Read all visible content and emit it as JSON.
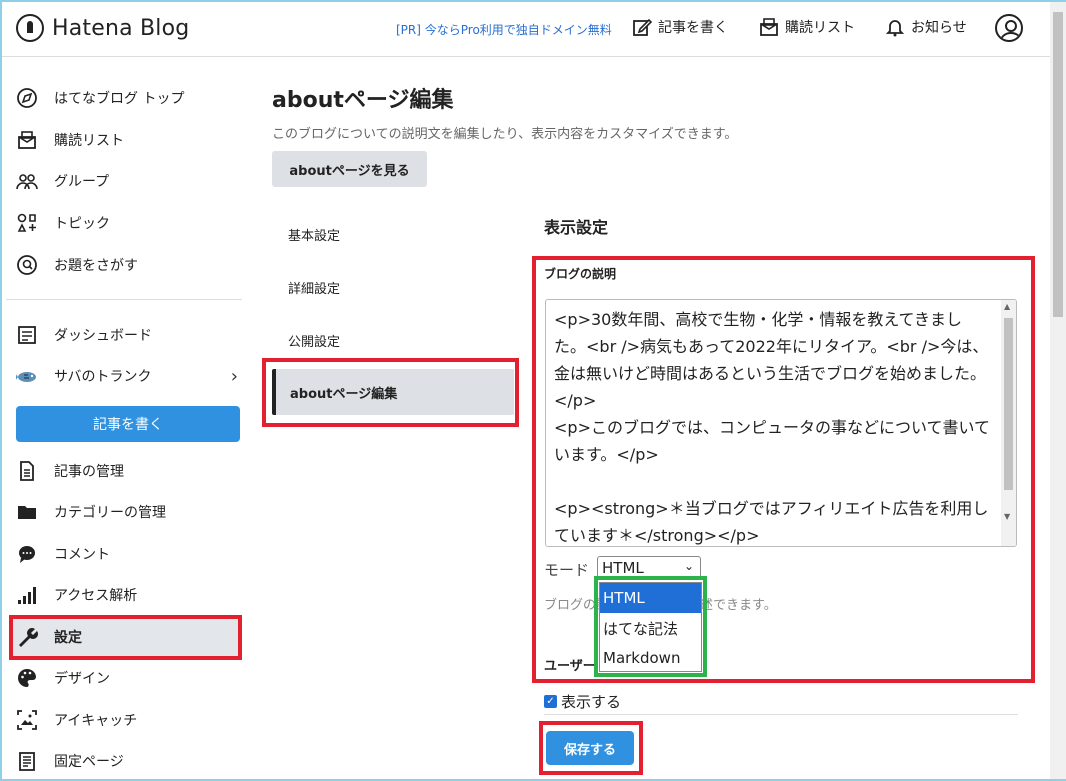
{
  "header": {
    "logo_text": "Hatena Blog",
    "pr_link": "[PR] 今ならPro利用で独自ドメイン無料",
    "write": "記事を書く",
    "reading_list": "購読リスト",
    "notifications": "お知らせ"
  },
  "sidebar": {
    "top_items": [
      {
        "label": "はてなブログ トップ",
        "icon": "compass-icon"
      },
      {
        "label": "購読リスト",
        "icon": "reading-list-icon"
      },
      {
        "label": "グループ",
        "icon": "group-icon"
      },
      {
        "label": "トピック",
        "icon": "topic-icon"
      },
      {
        "label": "お題をさがす",
        "icon": "search-theme-icon"
      }
    ],
    "dashboard": "ダッシュボード",
    "blog_name": "サバのトランク",
    "write_button": "記事を書く",
    "manage_items": [
      {
        "label": "記事の管理",
        "icon": "document-icon"
      },
      {
        "label": "カテゴリーの管理",
        "icon": "folder-icon"
      },
      {
        "label": "コメント",
        "icon": "comment-icon"
      },
      {
        "label": "アクセス解析",
        "icon": "bar-chart-icon"
      },
      {
        "label": "設定",
        "icon": "wrench-icon"
      },
      {
        "label": "デザイン",
        "icon": "palette-icon"
      },
      {
        "label": "アイキャッチ",
        "icon": "image-icon"
      },
      {
        "label": "固定ページ",
        "icon": "page-icon"
      }
    ]
  },
  "main": {
    "title": "aboutページ編集",
    "description": "このブログについての説明文を編集したり、表示内容をカスタマイズできます。",
    "view_button": "aboutページを見る",
    "subnav": [
      "基本設定",
      "詳細設定",
      "公開設定",
      "aboutページ編集"
    ],
    "section_title": "表示設定",
    "field_label": "ブログの説明",
    "textarea_value": "<p>30数年間、高校で生物・化学・情報を教えてきました。<br />病気もあって2022年にリタイア。<br />今は、金は無いけど時間はあるという生活でブログを始めました。</p>\n<p>このブログでは、コンピュータの事などについて書いています。</p>\n\n<p><strong>＊当ブログではアフィリエイト広告を利用しています＊</strong></p>",
    "mode_label": "モード",
    "mode_selected": "HTML",
    "mode_options": [
      "HTML",
      "はてな記法",
      "Markdown"
    ],
    "help_text": "ブログの説明など自由に記述できます。",
    "user_label": "ユーザー",
    "show_checkbox": "表示する",
    "save_button": "保存する"
  }
}
